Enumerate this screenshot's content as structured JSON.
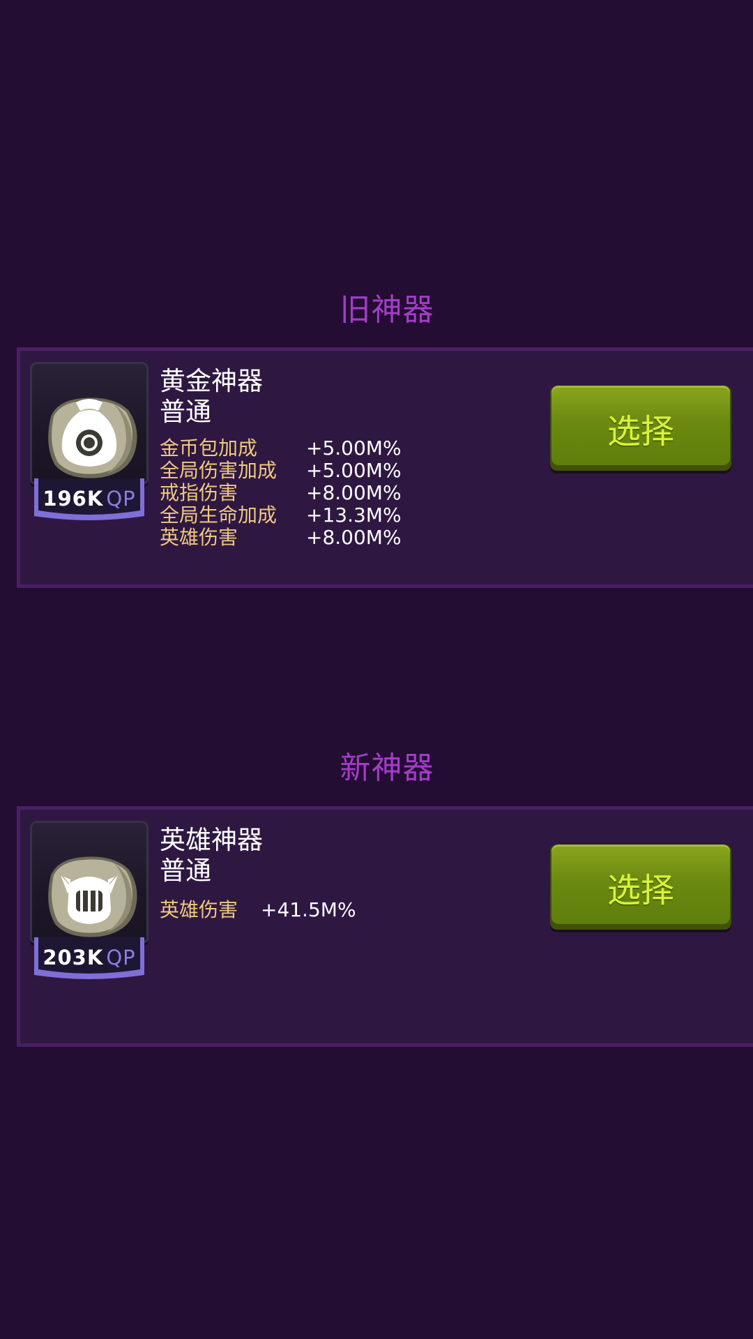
{
  "colors": {
    "background": "#230d33",
    "section_title": "#a43cc8",
    "card_background": "#2e1842",
    "card_border": "#4a1f66",
    "stat_label": "#f0c97e",
    "stat_value": "#ffffff",
    "button_face": "#6b8a10",
    "button_text": "#d9f23a",
    "qp_unit": "#8c7de0"
  },
  "old_section": {
    "title": "旧神器",
    "artifact": {
      "icon": "gold-bag-icon",
      "qp_value": "196K",
      "qp_unit": "QP",
      "name": "黄金神器",
      "rarity": "普通",
      "stats": [
        {
          "label": "金币包加成",
          "value": "+5.00M%"
        },
        {
          "label": "全局伤害加成",
          "value": "+5.00M%"
        },
        {
          "label": "戒指伤害",
          "value": "+8.00M%"
        },
        {
          "label": "全局生命加成",
          "value": "+13.3M%"
        },
        {
          "label": "英雄伤害",
          "value": "+8.00M%"
        }
      ],
      "button_label": "选择"
    }
  },
  "new_section": {
    "title": "新神器",
    "artifact": {
      "icon": "knight-helmet-icon",
      "qp_value": "203K",
      "qp_unit": "QP",
      "name": "英雄神器",
      "rarity": "普通",
      "stats": [
        {
          "label": "英雄伤害",
          "value": "+41.5M%"
        }
      ],
      "button_label": "选择"
    }
  }
}
